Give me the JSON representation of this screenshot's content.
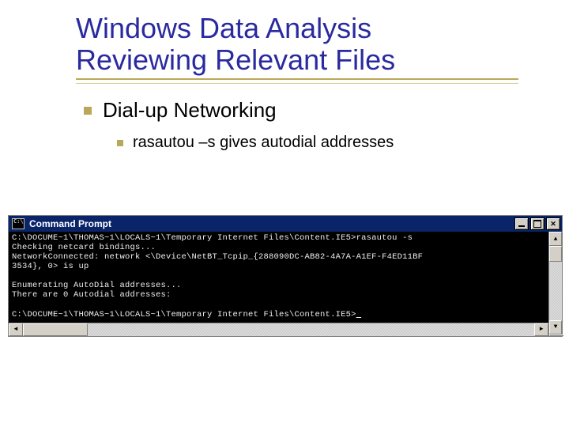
{
  "slide": {
    "title_line1": "Windows Data Analysis",
    "title_line2": "Reviewing Relevant Files",
    "bullet1": "Dial-up Networking",
    "bullet2": "rasautou –s gives autodial addresses"
  },
  "cmd": {
    "window_title": "Command Prompt",
    "lines": [
      "C:\\DOCUME~1\\THOMAS~1\\LOCALS~1\\Temporary Internet Files\\Content.IE5>rasautou -s",
      "Checking netcard bindings...",
      "NetworkConnected: network <\\Device\\NetBT_Tcpip_{288090DC-AB82-4A7A-A1EF-F4ED11BF",
      "3534}, 0> is up",
      "",
      "Enumerating AutoDial addresses...",
      "There are 0 Autodial addresses:",
      "",
      "C:\\DOCUME~1\\THOMAS~1\\LOCALS~1\\Temporary Internet Files\\Content.IE5>"
    ]
  }
}
